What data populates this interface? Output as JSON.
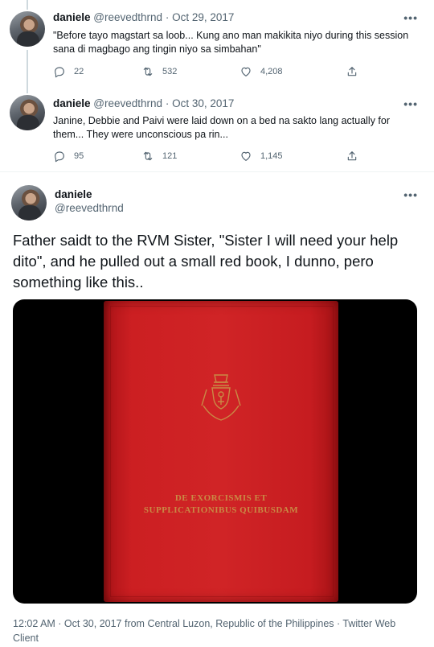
{
  "thread": [
    {
      "name": "daniele",
      "handle": "@reevedthrnd",
      "dot": "·",
      "date": "Oct 29, 2017",
      "text": "\"Before tayo magstart sa loob... Kung ano man makikita niyo during this session sana di magbago ang tingin niyo sa simbahan\"",
      "replies": "22",
      "retweets": "532",
      "likes": "4,208"
    },
    {
      "name": "daniele",
      "handle": "@reevedthrnd",
      "dot": "·",
      "date": "Oct 30, 2017",
      "text": "Janine, Debbie and Paivi were laid down on a bed na sakto lang actually for them... They were unconscious pa rin...",
      "replies": "95",
      "retweets": "121",
      "likes": "1,145"
    }
  ],
  "main": {
    "name": "daniele",
    "handle": "@reevedthrnd",
    "text": "Father saidt to the RVM Sister, \"Sister I will need your help dito\", and he pulled out a small red book, I dunno, pero something like this..",
    "media": {
      "book_title": "DE EXORCISMIS ET SUPPLICATIONIBUS QUIBUSDAM",
      "book_color": "#d02426",
      "emblem": "papal-coat-of-arms-icon"
    },
    "timestamp": "12:02 AM · Oct 30, 2017 from Central Luzon, Republic of the Philippines · Twitter Web Client"
  },
  "icons": {
    "more": "more-icon",
    "reply": "reply-icon",
    "retweet": "retweet-icon",
    "like": "heart-icon",
    "share": "share-icon"
  },
  "more_glyph": "•••",
  "colors": {
    "text": "#0f1419",
    "secondary": "#536471",
    "divider": "#eff3f4",
    "thread_line": "#cfd9de"
  }
}
